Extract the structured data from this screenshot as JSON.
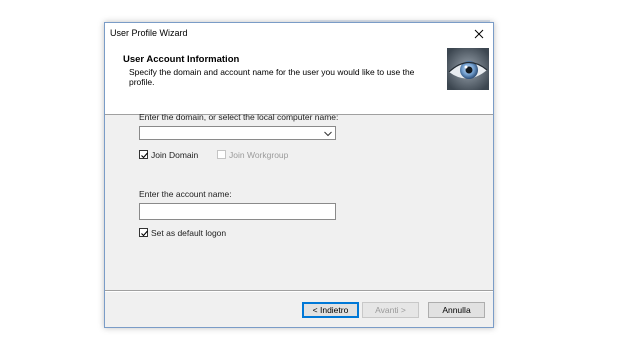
{
  "window": {
    "title": "User Profile Wizard",
    "close_label": "✕"
  },
  "header": {
    "title": "User Account Information",
    "subtitle": "Specify the domain and account name for the user you would like to use the profile.",
    "image_icon": "eye-icon"
  },
  "domain_section": {
    "label": "Enter the domain, or select the local computer name:",
    "combo_value": "",
    "join_domain": {
      "label": "Join Domain",
      "checked": true,
      "enabled": true
    },
    "join_workgroup": {
      "label": "Join Workgroup",
      "checked": false,
      "enabled": false
    }
  },
  "account_section": {
    "label": "Enter the account name:",
    "value": "",
    "default_logon": {
      "label": "Set as default logon",
      "checked": true,
      "enabled": true
    }
  },
  "buttons": {
    "back": "< Indietro",
    "next": "Avanti >",
    "cancel": "Annulla"
  },
  "colors": {
    "window_border": "#7a9cc7",
    "default_button_border": "#0078d7"
  }
}
